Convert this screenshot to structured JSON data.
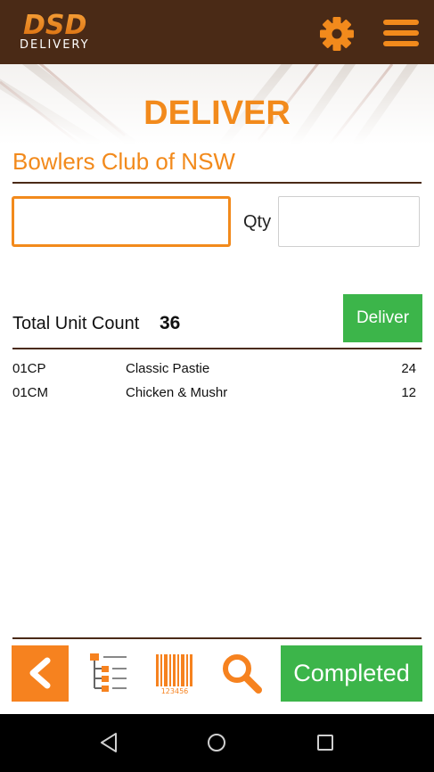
{
  "header": {
    "logo_mark": "DSD",
    "logo_sub": "DELIVERY",
    "settings_icon": "gear-icon",
    "menu_icon": "hamburger-menu-icon"
  },
  "page": {
    "title": "DELIVER",
    "customer": "Bowlers Club of NSW"
  },
  "form": {
    "code_value": "",
    "qty_label": "Qty",
    "qty_value": ""
  },
  "summary": {
    "total_label": "Total Unit Count",
    "total_value": "36",
    "deliver_label": "Deliver"
  },
  "items": [
    {
      "code": "01CP",
      "description": "Classic Pastie",
      "qty": "24"
    },
    {
      "code": "01CM",
      "description": "Chicken & Mushr",
      "qty": "12"
    }
  ],
  "footer": {
    "completed_label": "Completed",
    "icons": [
      "chevron-left-icon",
      "tree-list-icon",
      "barcode-icon",
      "search-icon"
    ],
    "barcode_digits": "123456"
  },
  "colors": {
    "brand_orange": "#f28a1c",
    "header_brown": "#4a2a16",
    "green": "#3cb54a"
  }
}
